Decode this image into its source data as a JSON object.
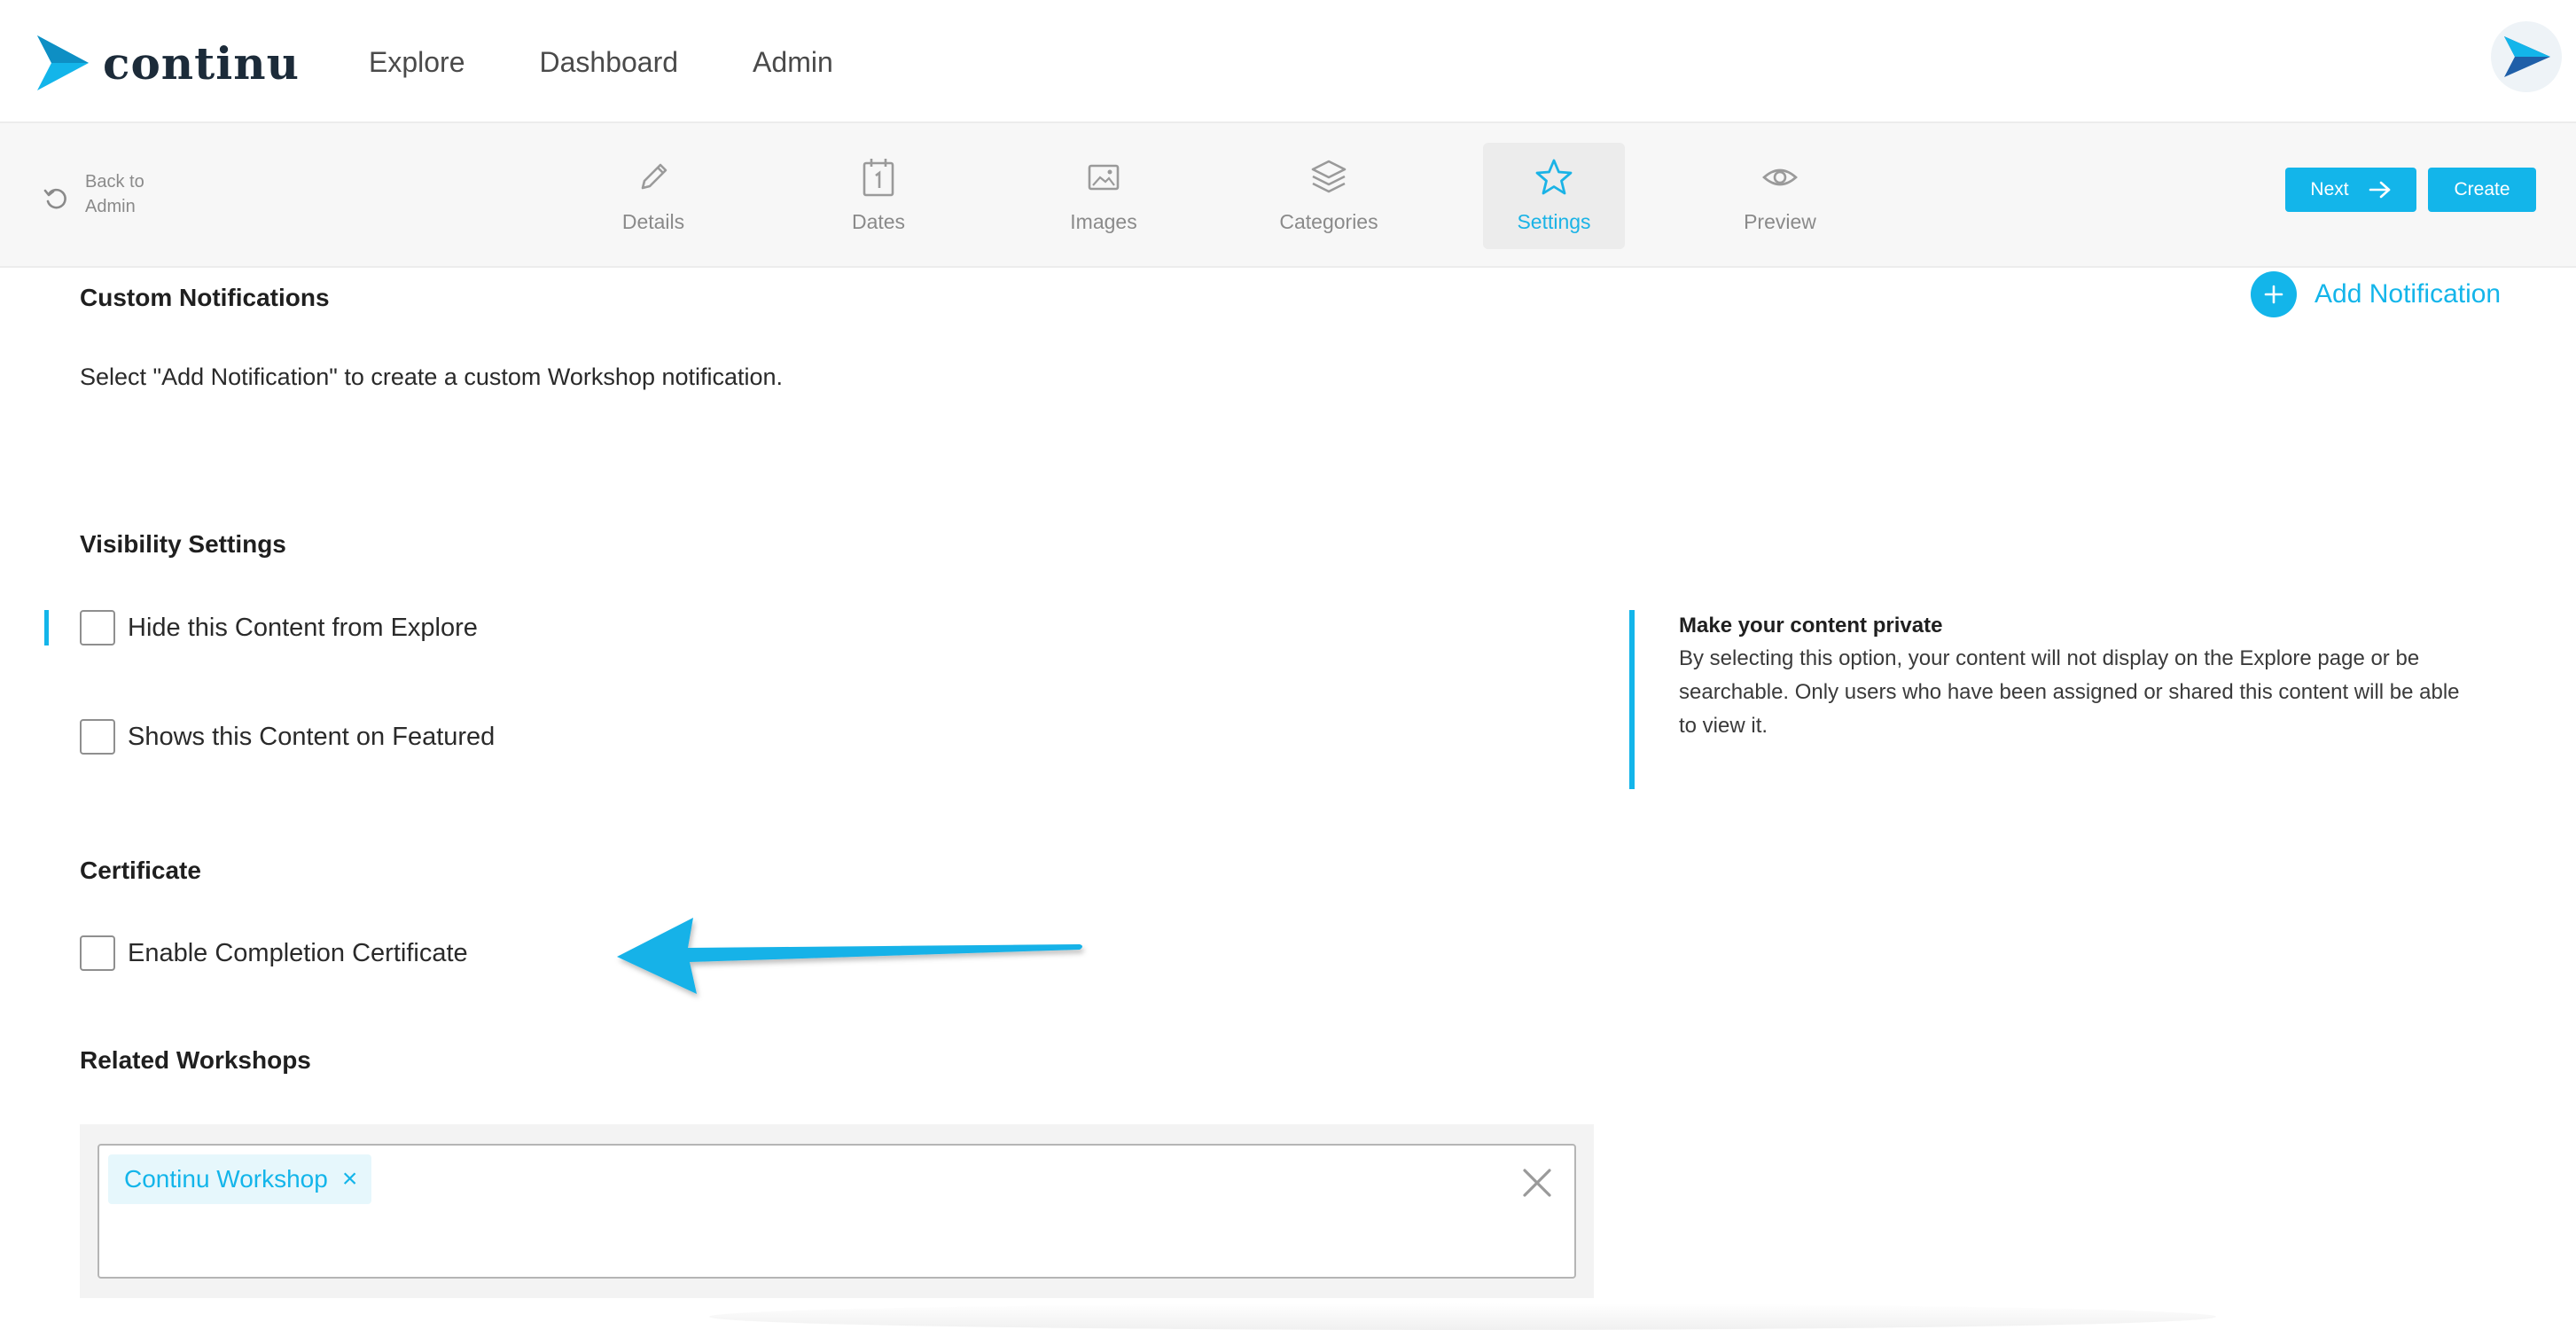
{
  "brand": {
    "name": "continu",
    "accent": "#13b5ea"
  },
  "nav": {
    "items": [
      {
        "label": "Explore"
      },
      {
        "label": "Dashboard"
      },
      {
        "label": "Admin"
      }
    ]
  },
  "toolbar": {
    "back_line1": "Back to",
    "back_line2": "Admin",
    "tabs": [
      {
        "label": "Details",
        "icon": "pencil-icon"
      },
      {
        "label": "Dates",
        "icon": "calendar-icon"
      },
      {
        "label": "Images",
        "icon": "image-icon"
      },
      {
        "label": "Categories",
        "icon": "layers-icon"
      },
      {
        "label": "Settings",
        "icon": "star-icon",
        "active": true
      },
      {
        "label": "Preview",
        "icon": "eye-icon"
      }
    ],
    "next_label": "Next",
    "create_label": "Create"
  },
  "notifications": {
    "title": "Custom Notifications",
    "add_label": "Add Notification",
    "description": "Select \"Add Notification\" to create a custom Workshop notification."
  },
  "visibility": {
    "title": "Visibility Settings",
    "options": [
      {
        "label": "Hide this Content from Explore",
        "checked": false
      },
      {
        "label": "Shows this Content on Featured",
        "checked": false
      }
    ],
    "info_title": "Make your content private",
    "info_line1": "By selecting this option, your content will not display on the Explore page or be",
    "info_line2": "searchable. Only users who have been assigned or shared this content will be able",
    "info_line3": "to view it."
  },
  "certificate": {
    "title": "Certificate",
    "option_label": "Enable Completion Certificate",
    "checked": false
  },
  "related": {
    "title": "Related Workshops",
    "tags": [
      {
        "label": "Continu Workshop",
        "remove": "×"
      }
    ]
  }
}
